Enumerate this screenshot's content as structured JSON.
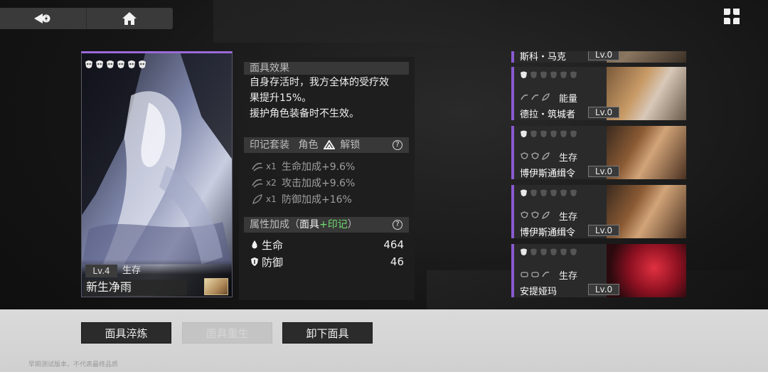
{
  "nav": {
    "back_icon": "back-arrow-icon",
    "home_icon": "home-icon",
    "menu_icon": "grid-menu-icon"
  },
  "mask_card": {
    "level": "Lv.4",
    "type": "生存",
    "name": "新生净雨",
    "pips": 6,
    "accent_color": "#9a6ad8"
  },
  "info": {
    "effect_header": "面具效果",
    "effect_lines": [
      "自身存活时，我方全体的受疗效",
      "果提升15%。",
      "援护角色装备时不生效。"
    ],
    "set_header": {
      "prefix": "印记套装",
      "role": "角色",
      "unlock": "解锁"
    },
    "set_bonuses": [
      {
        "mult": "x1",
        "text": "生命加成+9.6%"
      },
      {
        "mult": "x2",
        "text": "攻击加成+9.6%"
      },
      {
        "mult": "x1",
        "text": "防御加成+16%"
      }
    ],
    "attr_header": {
      "prefix": "属性加成（",
      "mask": "面具",
      "plus": "+印记",
      "suffix": "）"
    },
    "stats": [
      {
        "label": "生命",
        "value": "464"
      },
      {
        "label": "防御",
        "value": "46"
      }
    ]
  },
  "roster": [
    {
      "name": "斯科・马克",
      "level": "Lv.0",
      "type": ""
    },
    {
      "name": "德拉・筑城者",
      "level": "Lv.0",
      "type": "能量"
    },
    {
      "name": "博伊斯通缉令",
      "level": "Lv.0",
      "type": "生存"
    },
    {
      "name": "博伊斯通缉令",
      "level": "Lv.0",
      "type": "生存"
    },
    {
      "name": "安提娅玛",
      "level": "Lv.0",
      "type": "生存"
    }
  ],
  "buttons": {
    "refine": "面具淬炼",
    "reroll": "面具重生",
    "unequip": "卸下面具"
  },
  "footnote": "早期测试版本，不代表最终品质",
  "colors": {
    "accent_purple": "#9a6ad8",
    "green_highlight": "#6fdc6f"
  }
}
